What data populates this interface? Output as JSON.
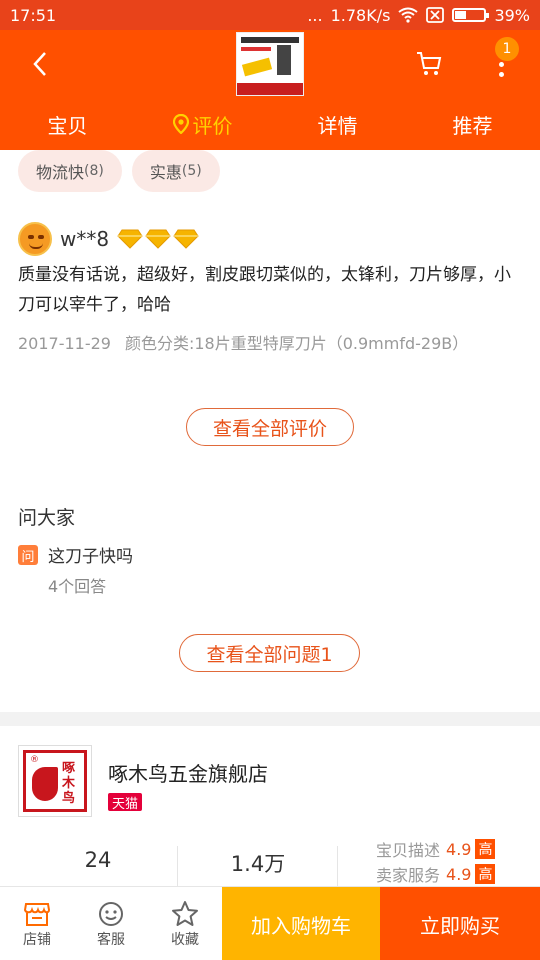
{
  "status_bar": {
    "time": "17:51",
    "signal_dots": "...",
    "speed": "1.78K/s",
    "battery_percent": "39%",
    "battery_level": 0.39
  },
  "header": {
    "notification_count": "1",
    "icons": [
      "back-icon",
      "cart-icon",
      "more-icon"
    ]
  },
  "tabs": [
    {
      "label": "宝贝",
      "active": false
    },
    {
      "label": "评价",
      "active": true
    },
    {
      "label": "详情",
      "active": false
    },
    {
      "label": "推荐",
      "active": false
    }
  ],
  "review_tags": [
    {
      "label": "物流快",
      "count": "(8)"
    },
    {
      "label": "实惠",
      "count": "(5)"
    }
  ],
  "review": {
    "username": "w**8",
    "text": "质量没有话说，超级好，割皮跟切菜似的，太锋利，刀片够厚，小刀可以宰牛了，哈哈",
    "date": "2017-11-29",
    "sku": "颜色分类:18片重型特厚刀片（0.9mmfd-29B）"
  },
  "view_all_reviews": "查看全部评价",
  "ask": {
    "title": "问大家",
    "icon_label": "问",
    "question": "这刀子快吗",
    "answers": "4个回答",
    "view_all": "查看全部问题1"
  },
  "store": {
    "logo_mark": "®",
    "logo_text": "啄木鸟",
    "name": "啄木鸟五金旗舰店",
    "tag": "天猫",
    "stats": [
      "24",
      "1.4万"
    ],
    "ratings": [
      {
        "label": "宝贝描述",
        "score": "4.9",
        "level": "高"
      },
      {
        "label": "卖家服务",
        "score": "4.9",
        "level": "高"
      }
    ]
  },
  "bottom_bar": {
    "items": [
      {
        "label": "店铺",
        "icon": "shop-icon"
      },
      {
        "label": "客服",
        "icon": "service-icon"
      },
      {
        "label": "收藏",
        "icon": "star-icon"
      }
    ],
    "add_to_cart": "加入购物车",
    "buy_now": "立即购买"
  },
  "colors": {
    "brand": "#ff5000",
    "status_bar": "#e8431a",
    "tab_active": "#ffd200",
    "cart_button": "#ffb400",
    "tmall": "#e4003a"
  }
}
